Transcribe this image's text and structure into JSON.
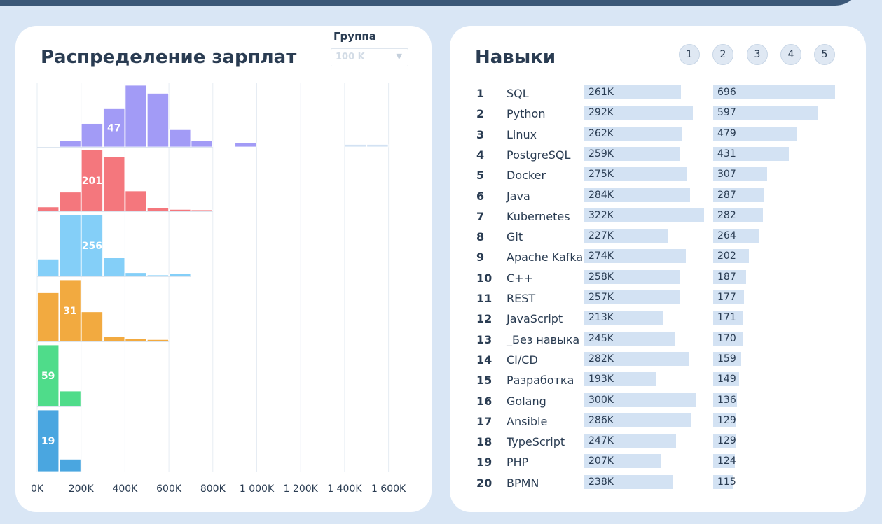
{
  "salary_card": {
    "title": "Распределение зарплат",
    "group_label": "Группа",
    "group_value": "100 K"
  },
  "skills_card": {
    "title": "Навыки",
    "pages": [
      "1",
      "2",
      "3",
      "4",
      "5"
    ]
  },
  "colors": {
    "band1": "#a29bf6",
    "band2": "#f4777d",
    "band3": "#84cff8",
    "band4": "#f2aa40",
    "band5": "#4fdc8a",
    "band6": "#4aa6e0",
    "faint": "#d3e2f3",
    "grid": "#e6ecf3"
  },
  "chart_data": [
    {
      "type": "bar",
      "title": "Распределение зарплат",
      "xlabel": "",
      "ylabel": "",
      "x_tick_labels": [
        "0K",
        "200K",
        "400K",
        "600K",
        "800K",
        "1 000K",
        "1 200K",
        "1 400K",
        "1 600K"
      ],
      "xlim": [
        0,
        1600000
      ],
      "bin_width": 100000,
      "grid": "vertical",
      "series": [
        {
          "labeled_value": 47,
          "labeled_bin": 3,
          "bins": [
            0,
            0.1,
            0.38,
            0.62,
            1.0,
            0.87,
            0.28,
            0.1,
            0,
            0.07,
            0,
            0,
            0,
            0,
            0.04,
            0.04
          ]
        },
        {
          "labeled_value": 201,
          "labeled_bin": 2,
          "bins": [
            0.07,
            0.31,
            1.0,
            0.89,
            0.33,
            0.06,
            0.03,
            0.01
          ]
        },
        {
          "labeled_value": 256,
          "labeled_bin": 2,
          "bins": [
            0.28,
            1.0,
            1.0,
            0.3,
            0.06,
            0.02,
            0.04
          ]
        },
        {
          "labeled_value": 31,
          "labeled_bin": 1,
          "bins": [
            0.79,
            1.0,
            0.48,
            0.08,
            0.05,
            0.03
          ]
        },
        {
          "labeled_value": 59,
          "labeled_bin": 0,
          "bins": [
            1.0,
            0.25
          ]
        },
        {
          "labeled_value": 19,
          "labeled_bin": 0,
          "bins": [
            1.0,
            0.2
          ]
        }
      ]
    },
    {
      "type": "bar",
      "title": "Навыки",
      "categories": [
        "SQL",
        "Python",
        "Linux",
        "PostgreSQL",
        "Docker",
        "Java",
        "Kubernetes",
        "Git",
        "Apache Kafka",
        "C++",
        "REST",
        "JavaScript",
        "_Без навыка",
        "CI/CD",
        "Разработка",
        "Golang",
        "Ansible",
        "TypeScript",
        "PHP",
        "BPMN"
      ],
      "ranks": [
        "1",
        "2",
        "3",
        "4",
        "5",
        "6",
        "7",
        "8",
        "9",
        "10",
        "11",
        "12",
        "13",
        "14",
        "15",
        "16",
        "17",
        "18",
        "19",
        "20"
      ],
      "salary_labels": [
        "261K",
        "292K",
        "262K",
        "259K",
        "275K",
        "284K",
        "322K",
        "227K",
        "274K",
        "258K",
        "257K",
        "213K",
        "245K",
        "282K",
        "193K",
        "300K",
        "286K",
        "247K",
        "207K",
        "238K"
      ],
      "salary_values": [
        261,
        292,
        262,
        259,
        275,
        284,
        322,
        227,
        274,
        258,
        257,
        213,
        245,
        282,
        193,
        300,
        286,
        247,
        207,
        238
      ],
      "count_labels": [
        "696",
        "597",
        "479",
        "431",
        "307",
        "287",
        "282",
        "264",
        "202",
        "187",
        "177",
        "171",
        "170",
        "159",
        "149",
        "136",
        "129",
        "129",
        "124",
        "115"
      ],
      "count_values": [
        696,
        597,
        479,
        431,
        307,
        287,
        282,
        264,
        202,
        187,
        177,
        171,
        170,
        159,
        149,
        136,
        129,
        129,
        124,
        115
      ]
    }
  ]
}
